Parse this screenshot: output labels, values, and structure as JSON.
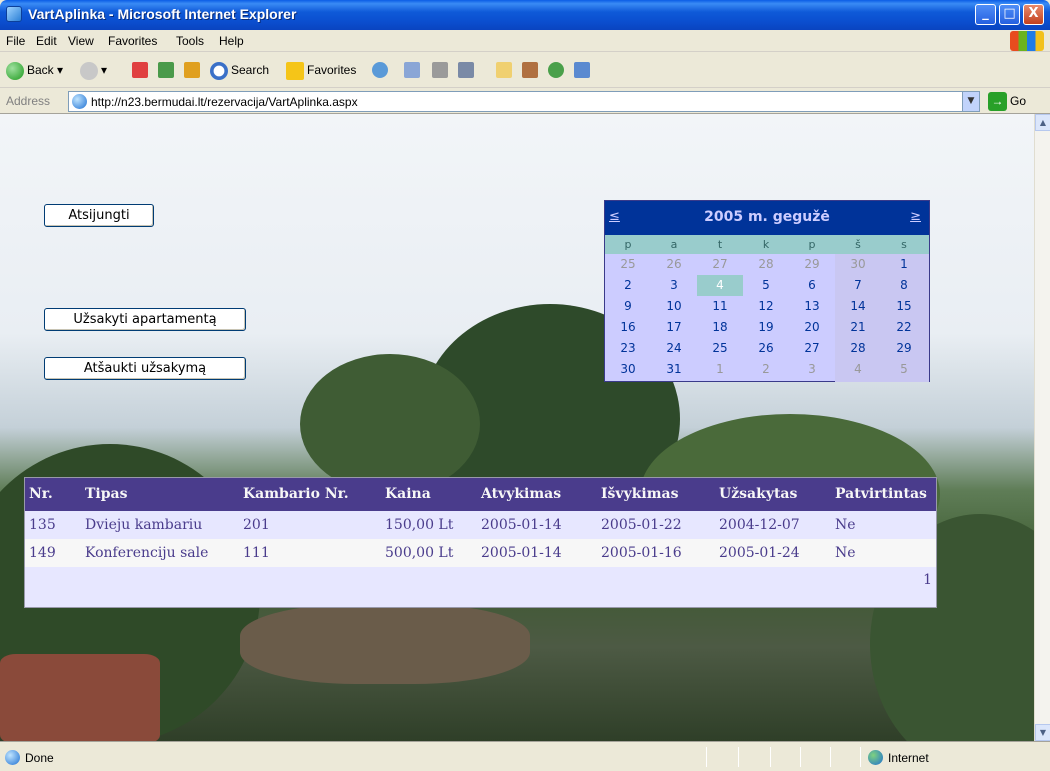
{
  "window": {
    "title": "VartAplinka - Microsoft Internet Explorer",
    "minimize": "_",
    "maximize": "□",
    "close": "X"
  },
  "menu": [
    "File",
    "Edit",
    "View",
    "Favorites",
    "Tools",
    "Help"
  ],
  "toolbar": {
    "back": "Back",
    "search": "Search",
    "favorites": "Favorites"
  },
  "address": {
    "label": "Address",
    "url": "http://n23.bermudai.lt/rezervacija/VartAplinka.aspx",
    "go": "Go"
  },
  "page": {
    "disconnect_button": "Atsijungti",
    "order_button": "Užsakyti apartamentą",
    "cancel_button": "Atšaukti užsakymą"
  },
  "calendar": {
    "title": "2005 m. gegužė",
    "prev": "≤",
    "next": "≥",
    "day_names": [
      "p",
      "a",
      "t",
      "k",
      "p",
      "š",
      "s"
    ],
    "weeks": [
      [
        "25",
        "26",
        "27",
        "28",
        "29",
        "30",
        "1"
      ],
      [
        "2",
        "3",
        "4",
        "5",
        "6",
        "7",
        "8"
      ],
      [
        "9",
        "10",
        "11",
        "12",
        "13",
        "14",
        "15"
      ],
      [
        "16",
        "17",
        "18",
        "19",
        "20",
        "21",
        "22"
      ],
      [
        "23",
        "24",
        "25",
        "26",
        "27",
        "28",
        "29"
      ],
      [
        "30",
        "31",
        "1",
        "2",
        "3",
        "4",
        "5"
      ]
    ],
    "selected_day": "4"
  },
  "table": {
    "headers": [
      "Nr.",
      "Tipas",
      "Kambario Nr.",
      "Kaina",
      "Atvykimas",
      "Išvykimas",
      "Užsakytas",
      "Patvirtintas"
    ],
    "rows": [
      [
        "135",
        "Dvieju kambariu",
        "201",
        "150,00 Lt",
        "2005-01-14",
        "2005-01-22",
        "2004-12-07",
        "Ne"
      ],
      [
        "149",
        "Konferenciju sale",
        "111",
        "500,00 Lt",
        "2005-01-14",
        "2005-01-16",
        "2005-01-24",
        "Ne"
      ]
    ],
    "pager": "1"
  },
  "status": {
    "text": "Done",
    "zone": "Internet"
  }
}
